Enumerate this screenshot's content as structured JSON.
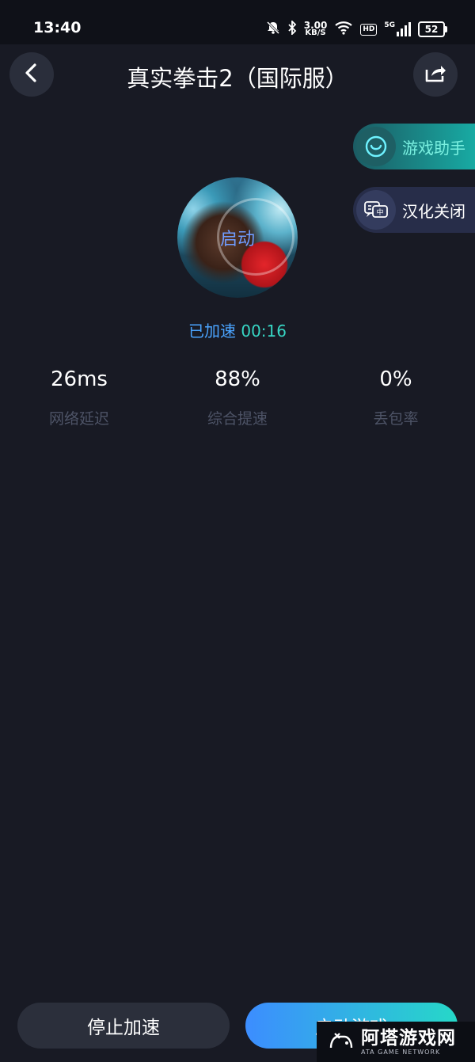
{
  "status_bar": {
    "time": "13:40",
    "net_speed": "3.00",
    "net_unit": "KB/S",
    "hd": "HD",
    "signal_label": "5G",
    "battery": "52",
    "icons": [
      "mute-bell-icon",
      "bluetooth-icon",
      "wifi-icon",
      "signal-icon",
      "battery-icon"
    ]
  },
  "header": {
    "title": "真实拳击2（国际服）",
    "back_icon": "back-chevron-icon",
    "share_icon": "share-icon"
  },
  "side_pills": [
    {
      "label": "游戏助手",
      "icon": "assistant-icon"
    },
    {
      "label": "汉化关闭",
      "icon": "translate-icon"
    }
  ],
  "game": {
    "launch_label": "启动",
    "accel_label": "已加速",
    "accel_time": "00:16"
  },
  "stats": [
    {
      "value": "26ms",
      "label": "网络延迟"
    },
    {
      "value": "88%",
      "label": "综合提速"
    },
    {
      "value": "0%",
      "label": "丢包率"
    }
  ],
  "bottom": {
    "stop_label": "停止加速",
    "start_label": "启动游戏"
  },
  "watermark": {
    "cn": "阿塔游戏网",
    "en": "ATA GAME NETWORK"
  },
  "colors": {
    "background": "#181a24",
    "accent_blue": "#4aa4ff",
    "accent_teal": "#37d6c4",
    "muted_text": "#4d5366"
  }
}
